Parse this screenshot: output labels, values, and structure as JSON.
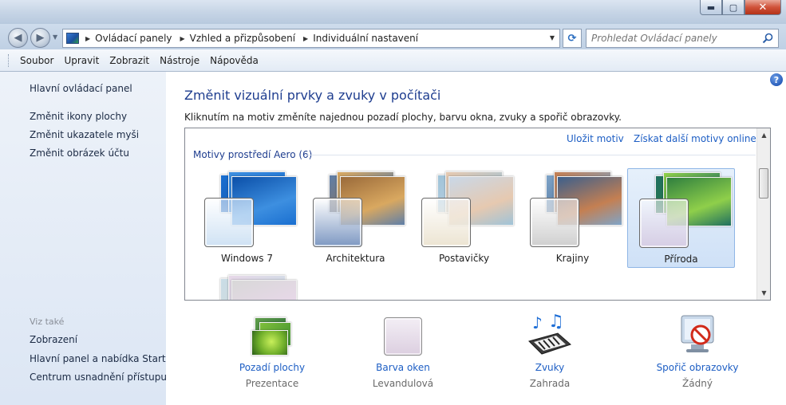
{
  "window": {
    "caption_buttons": {
      "minimize": "▬",
      "maximize": "▢",
      "close": "✕"
    }
  },
  "nav": {
    "back_icon": "◀",
    "forward_icon": "▶",
    "breadcrumb": [
      "Ovládací panely",
      "Vzhled a přizpůsobení",
      "Individuální nastavení"
    ],
    "refresh_icon": "⟳",
    "search_placeholder": "Prohledat Ovládací panely"
  },
  "menu": [
    "Soubor",
    "Upravit",
    "Zobrazit",
    "Nástroje",
    "Nápověda"
  ],
  "sidebar": {
    "links": [
      "Hlavní ovládací panel",
      "Změnit ikony plochy",
      "Změnit ukazatele myši",
      "Změnit obrázek účtu"
    ],
    "see_also_heading": "Viz také",
    "see_also": [
      "Zobrazení",
      "Hlavní panel a nabídka Start",
      "Centrum usnadnění přístupu"
    ]
  },
  "main": {
    "help_icon": "?",
    "title": "Změnit vizuální prvky a zvuky v počítači",
    "description": "Kliknutím na motiv změníte najednou pozadí plochy, barvu okna, zvuky a spořič obrazovky.",
    "save_theme": "Uložit motiv",
    "get_more": "Získat další motivy online",
    "group_header": "Motivy prostředí Aero (6)",
    "themes": [
      {
        "label": "Windows 7",
        "selected": false,
        "colors": [
          "#0b4fa8",
          "#3d8fe0",
          "#1a6fd0"
        ],
        "swatch": "#cfe2f4"
      },
      {
        "label": "Architektura",
        "selected": false,
        "colors": [
          "#9a6a3a",
          "#d9a860",
          "#5f7fa8"
        ],
        "swatch": "#7d98c2"
      },
      {
        "label": "Postavičky",
        "selected": false,
        "colors": [
          "#c9d8e8",
          "#e6c9b0",
          "#9fc3d8"
        ],
        "swatch": "#ece4d2"
      },
      {
        "label": "Krajiny",
        "selected": false,
        "colors": [
          "#3b5f8c",
          "#c47f52",
          "#7fa4c8"
        ],
        "swatch": "#cfcfcf"
      },
      {
        "label": "Příroda",
        "selected": true,
        "colors": [
          "#2f7f3f",
          "#8fcf4a",
          "#1f6f5f"
        ],
        "swatch": "#d6cde4"
      },
      {
        "label": "",
        "selected": false,
        "colors": [
          "#d8d8d8",
          "#e7d8e8",
          "#c9dde6"
        ],
        "swatch": "#e8e8e8"
      }
    ],
    "scroll_up": "▲",
    "scroll_down": "▼"
  },
  "bottom": [
    {
      "link": "Pozadí plochy",
      "value": "Prezentace",
      "icon": "desktop-background-icon"
    },
    {
      "link": "Barva oken",
      "value": "Levandulová",
      "icon": "window-color-icon",
      "color": "#dccfe0"
    },
    {
      "link": "Zvuky",
      "value": "Zahrada",
      "icon": "sounds-icon"
    },
    {
      "link": "Spořič obrazovky",
      "value": "Žádný",
      "icon": "screensaver-icon"
    }
  ]
}
